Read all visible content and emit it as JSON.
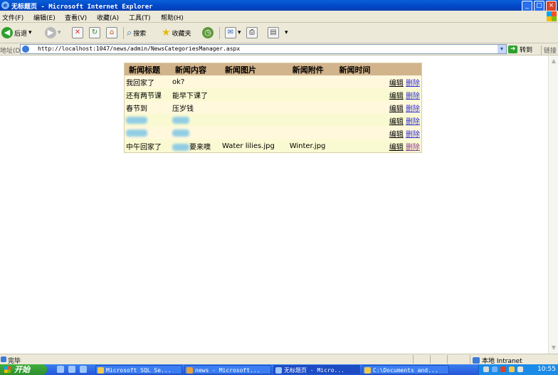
{
  "window": {
    "title": "无标题页 - Microsoft Internet Explorer"
  },
  "menubar": {
    "items": [
      "文件(F)",
      "编辑(E)",
      "查看(V)",
      "收藏(A)",
      "工具(T)",
      "帮助(H)"
    ]
  },
  "toolbar": {
    "back_label": "后退",
    "search_label": "搜索",
    "favorites_label": "收藏夹"
  },
  "address": {
    "label": "地址(D)",
    "url": "http://localhost:1047/news/admin/NewsCategoriesManager.aspx",
    "go_label": "转到",
    "links_label": "链接"
  },
  "table": {
    "headers": [
      "新闻标题",
      "新闻内容",
      "新闻图片",
      "新闻附件",
      "新闻时间"
    ],
    "edit_label": "编辑",
    "delete_label": "删除",
    "rows": [
      {
        "title": "我回家了",
        "content": "ok?",
        "image": "",
        "attachment": "",
        "time": "",
        "redacted_title": false,
        "redacted_content": false
      },
      {
        "title": "还有两节课",
        "content": "能早下课了",
        "image": "",
        "attachment": "",
        "time": "",
        "redacted_title": false,
        "redacted_content": false
      },
      {
        "title": "春节到",
        "content": "压岁钱",
        "image": "",
        "attachment": "",
        "time": "",
        "redacted_title": false,
        "redacted_content": false
      },
      {
        "title": "",
        "content": "",
        "image": "",
        "attachment": "",
        "time": "",
        "redacted_title": true,
        "redacted_content": true
      },
      {
        "title": "",
        "content": "",
        "image": "",
        "attachment": "",
        "time": "",
        "redacted_title": true,
        "redacted_content": true
      },
      {
        "title": "中午回家了",
        "content": "要来噢",
        "image": "Water lilies.jpg",
        "attachment": "Winter.jpg",
        "time": "",
        "redacted_title": false,
        "redacted_content": true
      }
    ]
  },
  "statusbar": {
    "status_text": "完毕",
    "zone_text": "本地 Intranet"
  },
  "taskbar": {
    "start_label": "开始",
    "tasks": [
      "Microsoft SQL Se...",
      "news - Microsoft...",
      "无标题页 - Micro...",
      "C:\\Documents and..."
    ],
    "clock": "10:55"
  },
  "colors": {
    "header_bg": "#d2b48c",
    "row_odd": "#fff8dc",
    "row_even": "#fafad2",
    "titlebar": "#0046c8"
  }
}
